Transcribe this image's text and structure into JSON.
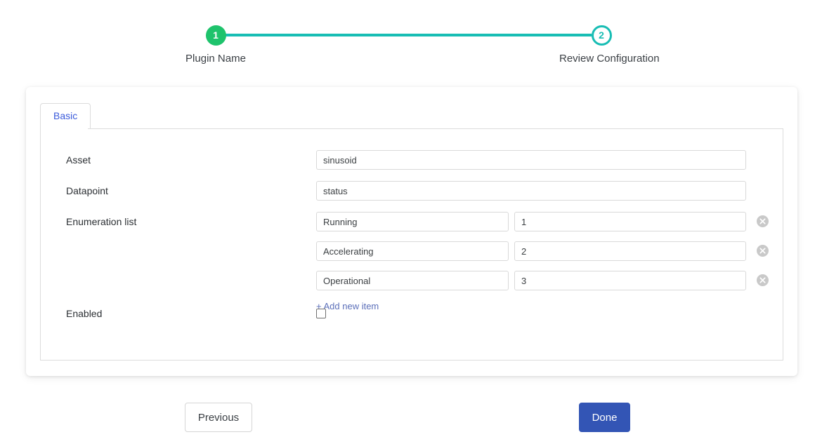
{
  "stepper": {
    "steps": [
      {
        "number": "1",
        "label": "Plugin Name",
        "state": "done"
      },
      {
        "number": "2",
        "label": "Review Configuration",
        "state": "current"
      }
    ],
    "accent_done_color": "#1ec36c",
    "accent_current_color": "#18bdb4",
    "track_color": "#18bdb4"
  },
  "card": {
    "tabs": [
      {
        "label": "Basic",
        "active": true
      }
    ],
    "tab_active_color": "#3b5bdb"
  },
  "form": {
    "asset": {
      "label": "Asset",
      "value": "sinusoid",
      "placeholder": ""
    },
    "datapoint": {
      "label": "Datapoint",
      "value": "status",
      "placeholder": ""
    },
    "enumeration_list": {
      "label": "Enumeration list",
      "items": [
        {
          "key": "Running",
          "value": "1"
        },
        {
          "key": "Accelerating",
          "value": "2"
        },
        {
          "key": "Operational",
          "value": "3"
        }
      ],
      "add_label": "+ Add new item",
      "remove_icon": "close-circle-icon"
    },
    "enabled": {
      "label": "Enabled",
      "checked": false
    }
  },
  "footer": {
    "previous_label": "Previous",
    "done_label": "Done",
    "done_color": "#3355b5"
  }
}
